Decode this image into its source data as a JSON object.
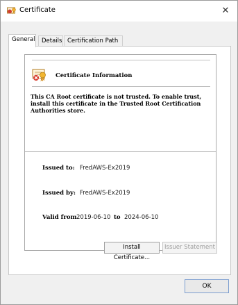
{
  "window": {
    "title": "Certificate",
    "close_glyph": "✕"
  },
  "tabs": [
    {
      "label": "General",
      "active": true
    },
    {
      "label": "Details",
      "active": false
    },
    {
      "label": "Certification Path",
      "active": false
    }
  ],
  "general": {
    "info_title": "Certificate Information",
    "warning_text": "This CA Root certificate is not trusted. To enable trust, install this certificate in the Trusted Root Certification Authorities store.",
    "issued_to_label": "Issued to:",
    "issued_to_value": "FredAWS-Ex2019",
    "issued_by_label": "Issued by:",
    "issued_by_value": "FredAWS-Ex2019",
    "valid_from_label": "Valid from",
    "valid_from_value": "2019-06-10",
    "valid_to_label": "to",
    "valid_to_value": "2024-06-10"
  },
  "buttons": {
    "install_certificate": "Install Certificate...",
    "issuer_statement": "Issuer Statement",
    "ok": "OK"
  },
  "icons": {
    "title_icon": "certificate-icon",
    "info_icon": "untrusted-certificate-icon"
  }
}
